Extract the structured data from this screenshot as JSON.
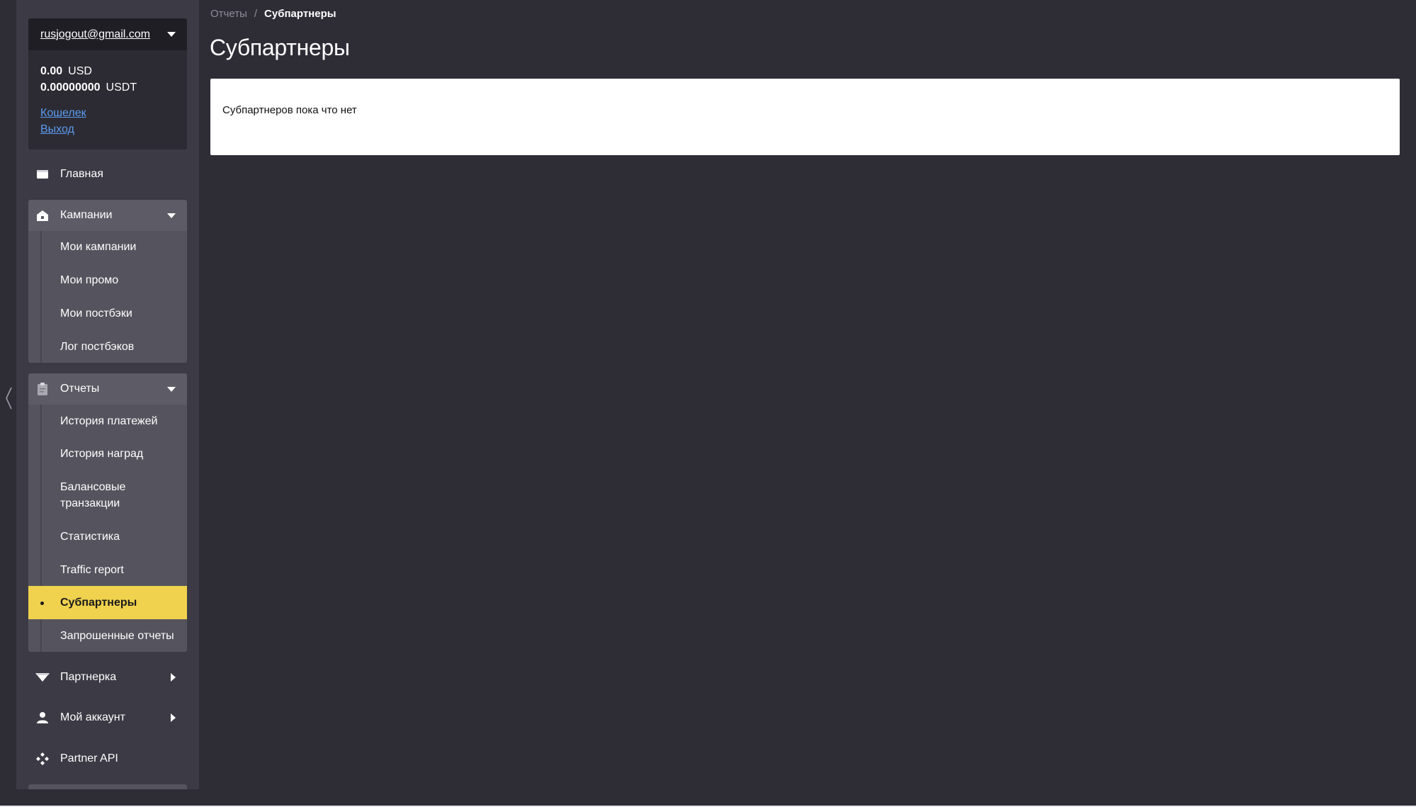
{
  "sidebar": {
    "user": {
      "email": "rusjogout@gmail.com",
      "balances": [
        {
          "amount": "0.00",
          "currency": "USD"
        },
        {
          "amount": "0.00000000",
          "currency": "USDT"
        }
      ],
      "wallet_label": "Кошелек",
      "logout_label": "Выход"
    },
    "nav": {
      "home": {
        "label": "Главная",
        "icon": "wallet-icon"
      },
      "campaigns": {
        "label": "Кампании",
        "icon": "house-icon",
        "expanded": true,
        "items": [
          "Мои кампании",
          "Мои промо",
          "Мои постбэки",
          "Лог постбэков"
        ]
      },
      "reports": {
        "label": "Отчеты",
        "icon": "clipboard-icon",
        "expanded": true,
        "items": [
          "История платежей",
          "История наград",
          "Балансовые транзакции",
          "Статистика",
          "Traffic report",
          "Субпартнеры",
          "Запрошенные отчеты"
        ],
        "active_item": "Субпартнеры"
      },
      "partner": {
        "label": "Партнерка",
        "icon": "diamond-icon",
        "expanded": false
      },
      "account": {
        "label": "Мой аккаунт",
        "icon": "user-icon",
        "expanded": false
      },
      "api": {
        "label": "Partner API",
        "icon": "api-icon"
      }
    }
  },
  "breadcrumb": {
    "parent": "Отчеты",
    "separator": "/",
    "current": "Субпартнеры"
  },
  "main": {
    "title": "Субпартнеры",
    "empty_message": "Субпартнеров пока что нет"
  },
  "colors": {
    "background": "#2e2d36",
    "sidebar": "#3c3b45",
    "active_item": "#f0d24e",
    "link": "#5b9bf0"
  }
}
